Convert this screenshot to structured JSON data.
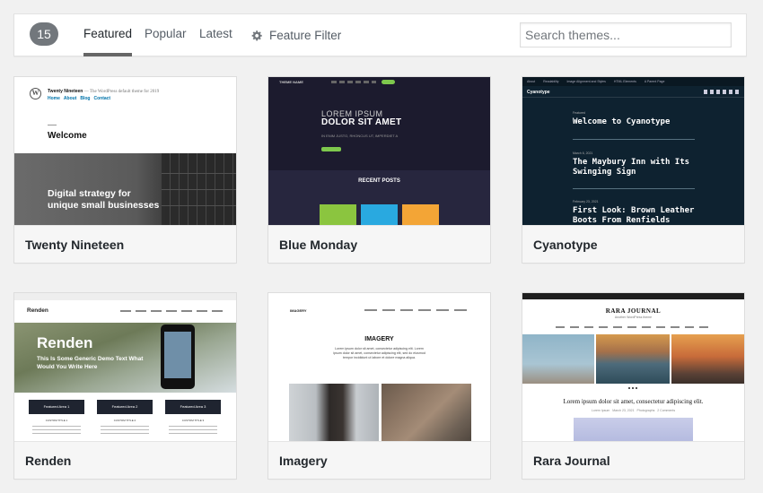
{
  "filter": {
    "count": "15",
    "tabs": {
      "featured": "Featured",
      "popular": "Popular",
      "latest": "Latest"
    },
    "feature_filter": "Feature Filter",
    "search_placeholder": "Search themes..."
  },
  "themes": [
    {
      "name": "Twenty Nineteen",
      "preview": {
        "site_title": "Twenty Nineteen",
        "tagline": "— The WordPress default theme for 2019",
        "menu": [
          "Home",
          "About",
          "Blog",
          "Contact"
        ],
        "welcome": "Welcome",
        "hero_line1": "Digital strategy for",
        "hero_line2": "unique small businesses"
      }
    },
    {
      "name": "Blue Monday",
      "preview": {
        "logo": "THEME NAME",
        "hero_line1": "LOREM IPSUM",
        "hero_line2": "DOLOR SIT AMET",
        "hero_sub": "IN ENIM JUSTO, RHONCUS UT, IMPERDIET A",
        "recent_posts": "RECENT POSTS"
      }
    },
    {
      "name": "Cyanotype",
      "preview": {
        "nav": [
          "About",
          "Readability",
          "Image Alignment and Styles",
          "HTML Elements",
          "A Parent Page"
        ],
        "site_title": "Cyanotype",
        "post1_label": "Featured",
        "post1_title": "Welcome to Cyanotype",
        "post2_date": "March 6, 2021",
        "post2_title": "The Maybury Inn with Its Swinging Sign",
        "post3_date": "February 23, 2021",
        "post3_title": "First Look: Brown Leather Boots From Renfields"
      }
    },
    {
      "name": "Renden",
      "preview": {
        "site_title": "Renden",
        "hero_title": "Renden",
        "hero_sub": "This Is Some Generic Demo Text What Would You Write Here",
        "features": [
          "Featured Area 1",
          "Featured Area 2",
          "Featured Area 3"
        ],
        "custom_titles": [
          "CUSTOM TITLE 1",
          "CUSTOM TITLE 2",
          "CUSTOM TITLE 3"
        ]
      }
    },
    {
      "name": "Imagery",
      "preview": {
        "logo": "IMAGERY",
        "heading": "IMAGERY",
        "body": "Lorem ipsum dolor sit amet, consectetur adipiscing elit. Lorem ipsum dolor sit amet, consectetur adipiscing elit, sed do eiusmod tempor incididunt ut labore et dolore magna aliqua."
      }
    },
    {
      "name": "Rara Journal",
      "preview": {
        "site_title": "RARA JOURNAL",
        "tagline": "Another WordPress theme",
        "headline": "Lorem ipsum dolor sit amet, consectetur adipiscing elit.",
        "meta": "Lorem Ipsum   March 23, 2021   Photographs   2 Comments"
      }
    }
  ]
}
